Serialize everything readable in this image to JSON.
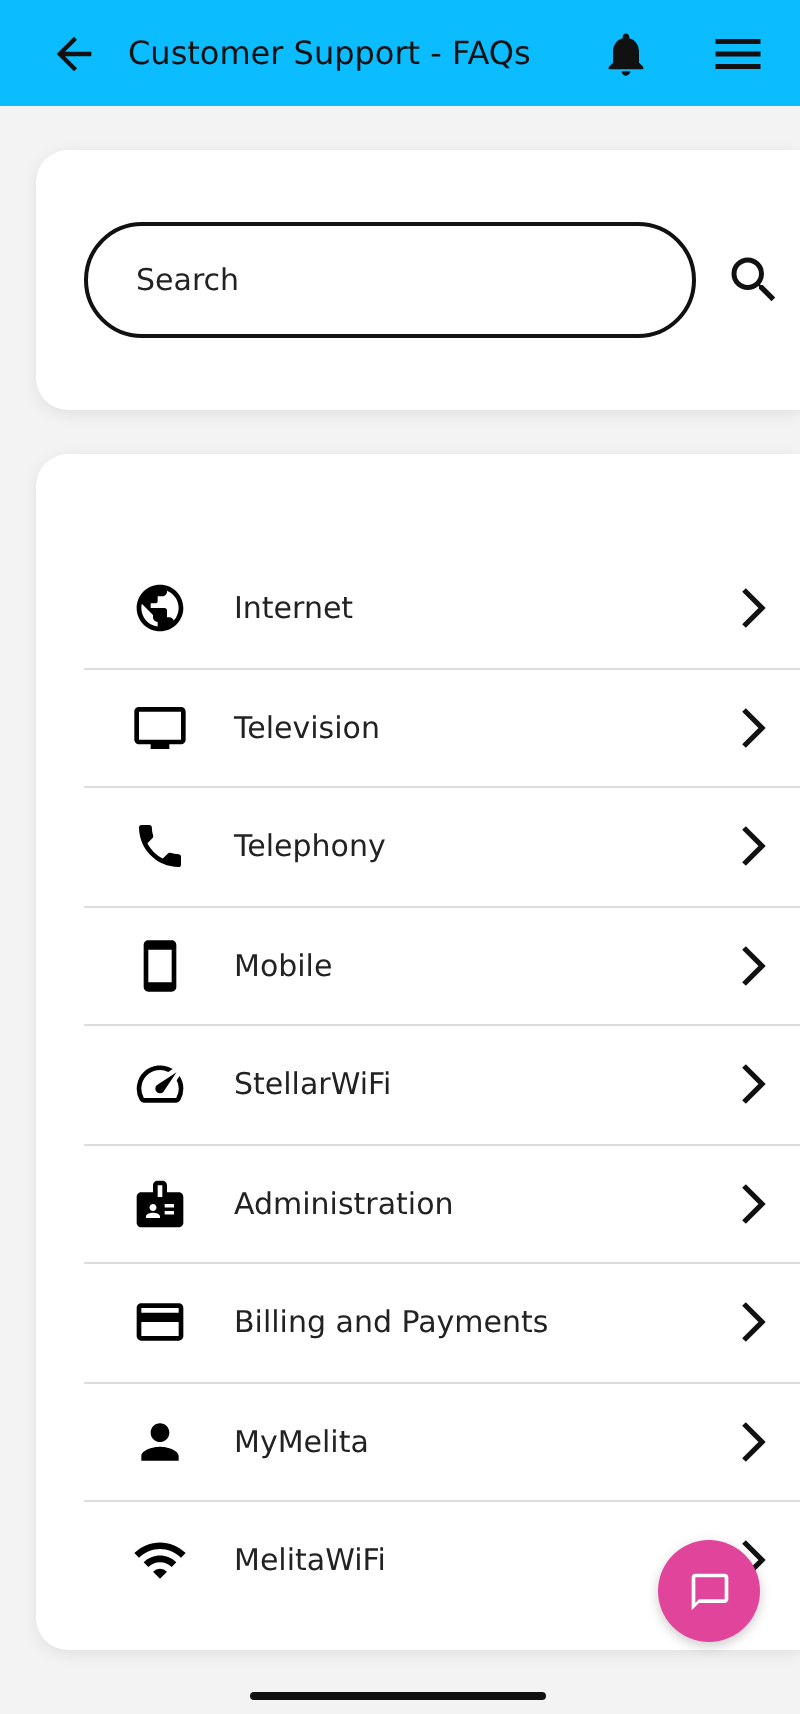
{
  "header": {
    "title": "Customer Support - FAQs"
  },
  "search": {
    "placeholder": "Search"
  },
  "categories": [
    {
      "label": "Internet",
      "kind": "globe"
    },
    {
      "label": "Television",
      "kind": "tv"
    },
    {
      "label": "Telephony",
      "kind": "phone"
    },
    {
      "label": "Mobile",
      "kind": "mobile"
    },
    {
      "label": "StellarWiFi",
      "kind": "gauge"
    },
    {
      "label": "Administration",
      "kind": "badge"
    },
    {
      "label": "Billing and Payments",
      "kind": "card"
    },
    {
      "label": "MyMelita",
      "kind": "person"
    },
    {
      "label": "MelitaWiFi",
      "kind": "wifi"
    }
  ]
}
